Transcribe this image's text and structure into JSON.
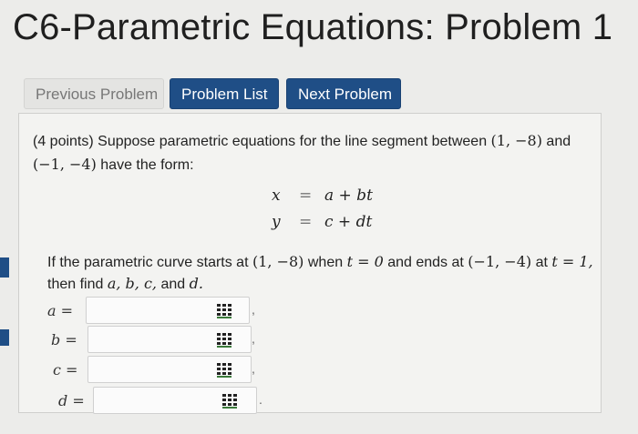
{
  "header": {
    "title": "C6-Parametric Equations: Problem 1"
  },
  "nav": {
    "previous": "Previous Problem",
    "list": "Problem List",
    "next": "Next Problem"
  },
  "problem": {
    "points": "(4 points)",
    "intro_text": "Suppose parametric equations for the line segment between",
    "point1": "(1, −8)",
    "and": "and",
    "point2": "(−1, −4)",
    "form_text": "have the form:",
    "equations": [
      {
        "lhs": "x",
        "sign": "=",
        "rhs": "a + bt"
      },
      {
        "lhs": "y",
        "sign": "=",
        "rhs": "c + dt"
      }
    ],
    "q_part1": "If the parametric curve starts at",
    "q_start": "(1, −8)",
    "q_when": "when",
    "q_t0": "t = 0",
    "q_ends": "and ends at",
    "q_end": "(−1, −4)",
    "q_at": "at",
    "q_t1": "t = 1,",
    "q_part2": "then find",
    "q_vars": "a, b, c,",
    "q_and": "and",
    "q_d": "d."
  },
  "answers": [
    {
      "label": "a =",
      "value": "",
      "sep": ","
    },
    {
      "label": "b =",
      "value": "",
      "sep": ","
    },
    {
      "label": "c =",
      "value": "",
      "sep": ","
    },
    {
      "label": "d =",
      "value": "",
      "sep": "."
    }
  ],
  "icons": {
    "answer_tool": "equation-editor-grid-icon"
  },
  "colors": {
    "primary_button": "#1f4e86",
    "disabled_button": "#e4e4e2",
    "page_bg": "#ececea"
  }
}
